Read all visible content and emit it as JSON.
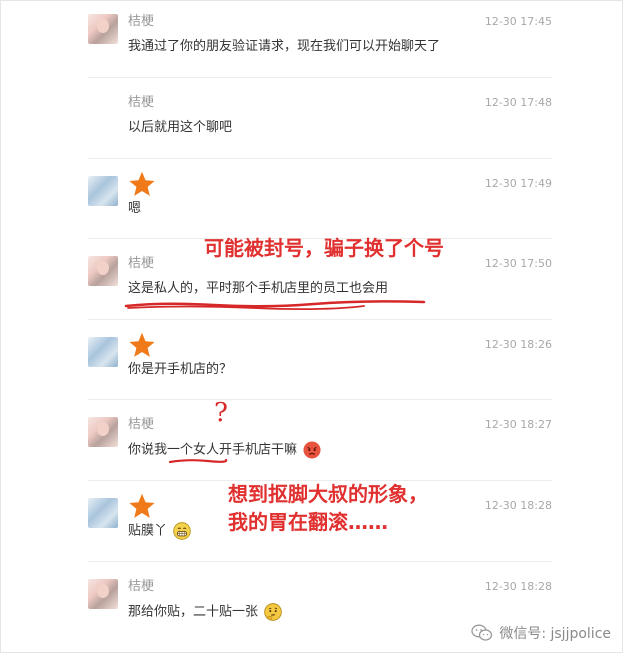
{
  "messages": [
    {
      "sender": "桔梗",
      "time": "12-30 17:45",
      "text": "我通过了你的朋友验证请求，现在我们可以开始聊天了",
      "avatar": "girl"
    },
    {
      "sender": "桔梗",
      "time": "12-30 17:48",
      "text": "以后就用这个聊吧",
      "avatar": "none"
    },
    {
      "sender": "",
      "time": "12-30 17:49",
      "text": "嗯",
      "avatar": "blue"
    },
    {
      "sender": "桔梗",
      "time": "12-30 17:50",
      "text": "这是私人的，平时那个手机店里的员工也会用",
      "avatar": "girl"
    },
    {
      "sender": "",
      "time": "12-30 18:26",
      "text": "你是开手机店的？",
      "avatar": "blue"
    },
    {
      "sender": "桔梗",
      "time": "12-30 18:27",
      "text": "你说我一个女人开手机店干嘛",
      "avatar": "girl",
      "emoji": "angry-face-icon"
    },
    {
      "sender": "",
      "time": "12-30 18:28",
      "text": "贴膜丫",
      "avatar": "blue",
      "emoji": "grin-face-icon"
    },
    {
      "sender": "桔梗",
      "time": "12-30 18:28",
      "text": "那给你贴，二十贴一张",
      "avatar": "girl",
      "emoji": "thinking-face-icon"
    }
  ],
  "annotations": {
    "note1": "可能被封号，骗子换了个号",
    "note2_line1": "想到抠脚大叔的形象，",
    "note2_line2": "我的胃在翻滚……",
    "question_mark": "?"
  },
  "watermark": {
    "text": "微信号: jsjjpolice"
  },
  "colors": {
    "annotation": "#e0302f",
    "star": "#f07a1a"
  }
}
